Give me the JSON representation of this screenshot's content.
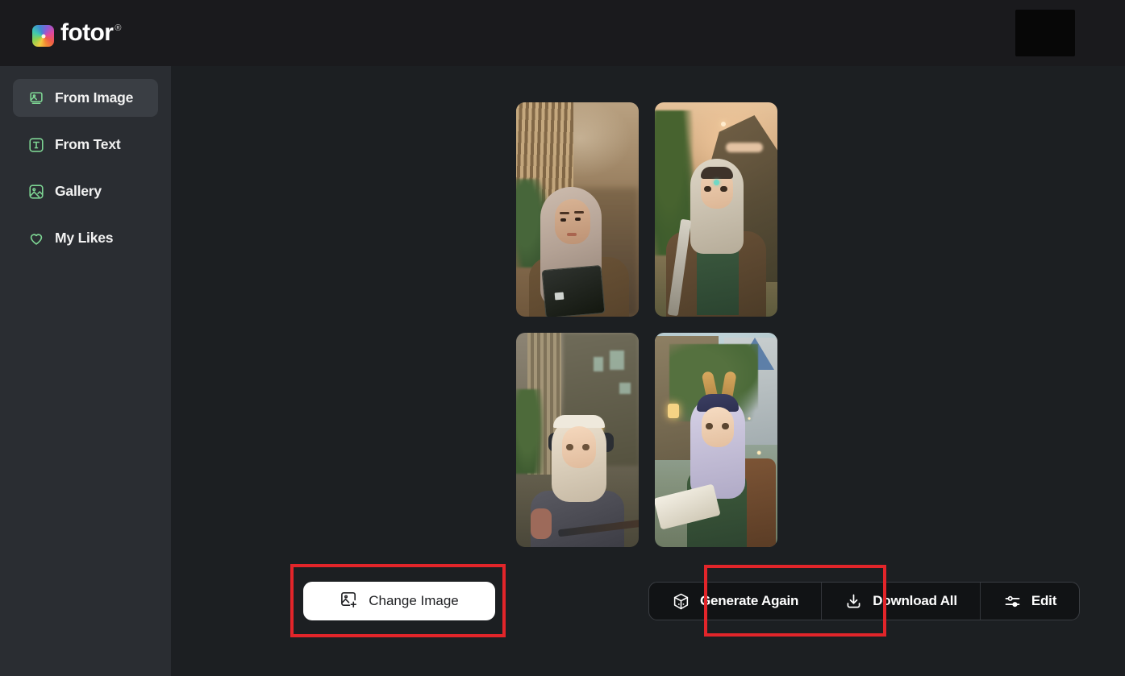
{
  "app": {
    "brand_name": "fotor",
    "brand_trademark": "®",
    "brand_icon": "fotor-logo-icon"
  },
  "header": {
    "redacted_box": ""
  },
  "sidebar": {
    "items": [
      {
        "label": "From Image",
        "icon": "from-image-icon",
        "active": true
      },
      {
        "label": "From Text",
        "icon": "from-text-icon",
        "active": false
      },
      {
        "label": "Gallery",
        "icon": "gallery-icon",
        "active": false
      },
      {
        "label": "My Likes",
        "icon": "heart-icon",
        "active": false
      }
    ]
  },
  "results": {
    "images": [
      {
        "alt": "Woman in hijab holding a laptop in a cafe"
      },
      {
        "alt": "Anime warrior with hood and sword in mountains"
      },
      {
        "alt": "Anime girl with headphones holding a rifle in a city"
      },
      {
        "alt": "Fantasy elf girl with scroll in a village"
      }
    ]
  },
  "actions": {
    "change_image": {
      "label": "Change Image",
      "icon": "add-image-icon"
    },
    "generate_again": {
      "label": "Generate Again",
      "icon": "dice-icon"
    },
    "download_all": {
      "label": "Download All",
      "icon": "download-icon"
    },
    "edit": {
      "label": "Edit",
      "icon": "sliders-icon"
    }
  },
  "annotations": {
    "highlight_color": "#e2252a",
    "boxes": [
      {
        "target": "change-image-button"
      },
      {
        "target": "download-all-button"
      }
    ]
  },
  "colors": {
    "header_bg": "#1a1a1d",
    "sidebar_bg": "#2a2d32",
    "main_bg": "#1c1f22",
    "accent_green": "#7ed694",
    "white_button_bg": "#ffffff",
    "annotation_red": "#e2252a"
  }
}
